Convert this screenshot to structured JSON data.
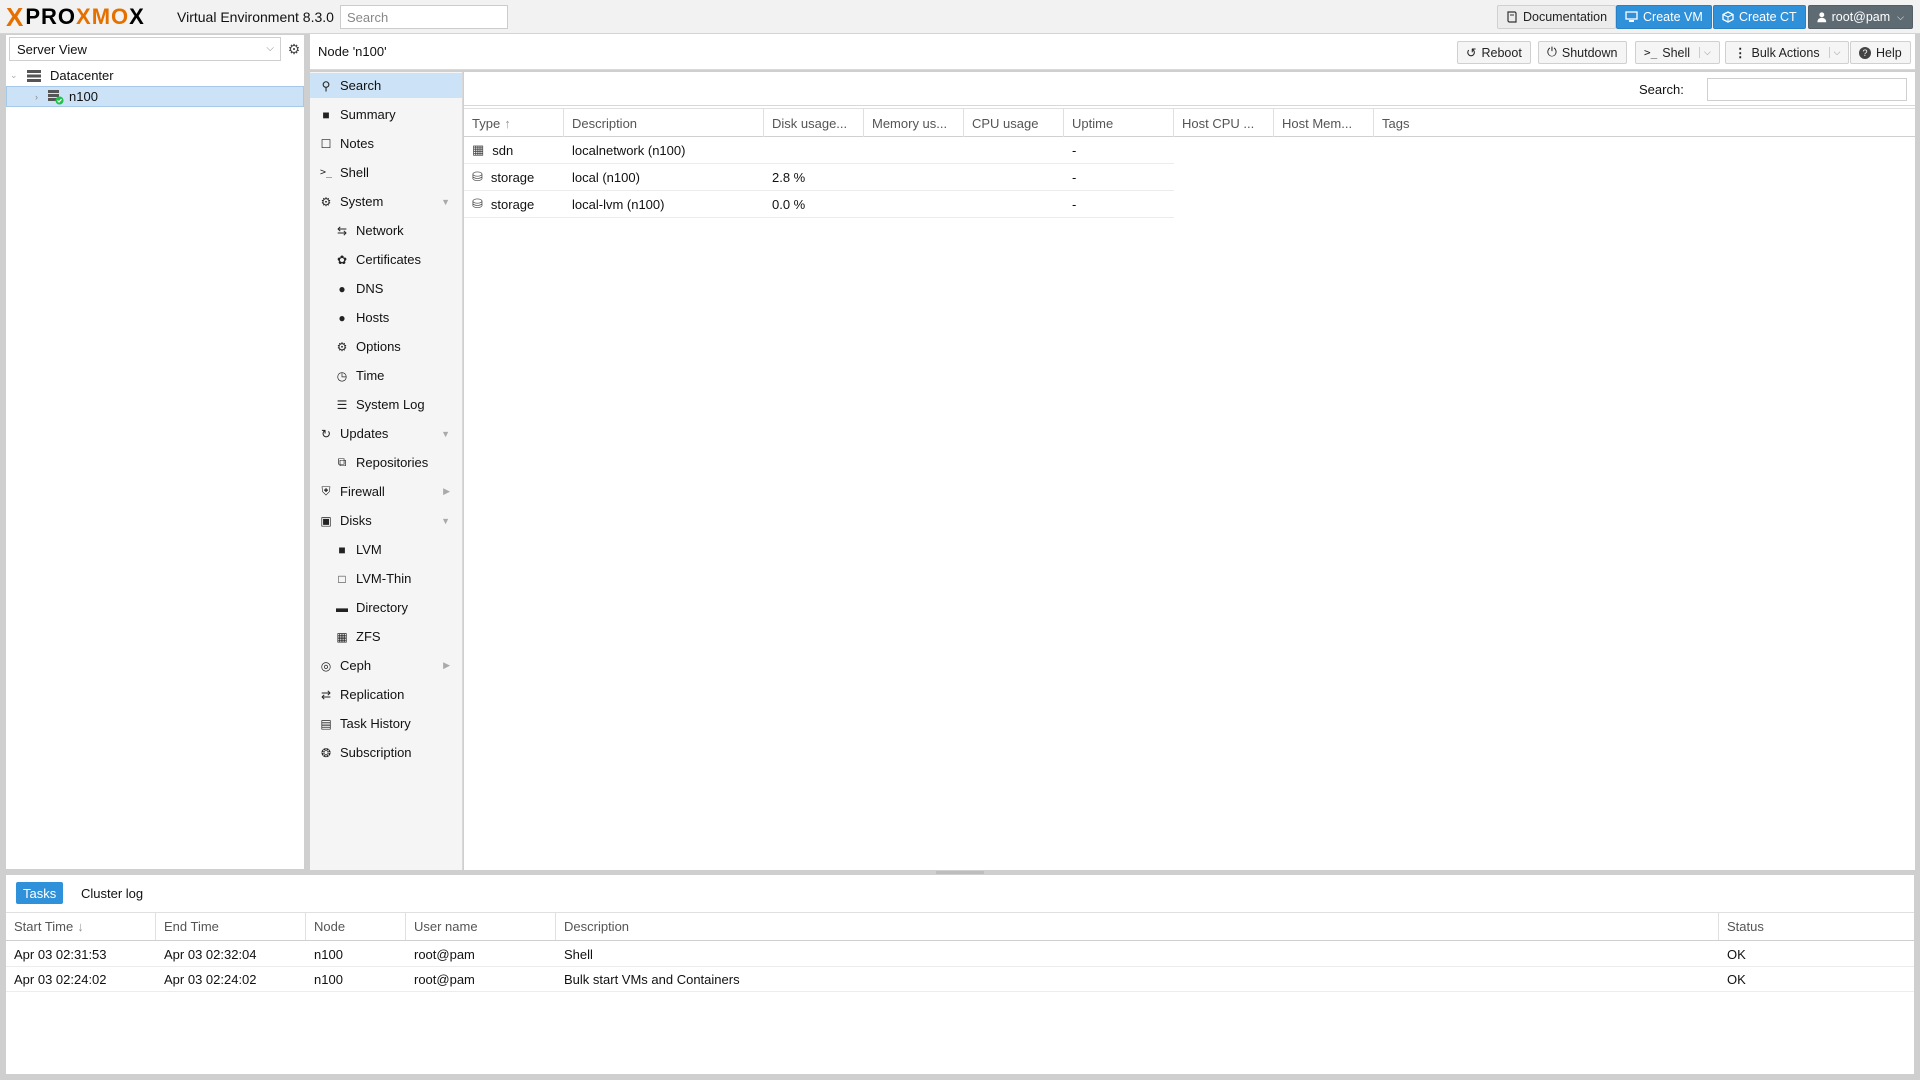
{
  "app": {
    "logo_x": "X",
    "logo_word_a": "PRO",
    "logo_word_b": "XMO",
    "logo_word_c": "X",
    "version": "Virtual Environment 8.3.0",
    "search_placeholder": "Search"
  },
  "topbar": {
    "documentation": "Documentation",
    "create_vm": "Create VM",
    "create_ct": "Create CT",
    "user": "root@pam"
  },
  "tree": {
    "view": "Server View",
    "datacenter": "Datacenter",
    "node": "n100"
  },
  "node_header": {
    "title": "Node 'n100'",
    "reboot": "Reboot",
    "shutdown": "Shutdown",
    "shell": "Shell",
    "bulk_actions": "Bulk Actions",
    "help": "Help"
  },
  "nav": [
    {
      "label": "Search",
      "icon": "search-icon"
    },
    {
      "label": "Summary",
      "icon": "book-icon"
    },
    {
      "label": "Notes",
      "icon": "notes-icon"
    },
    {
      "label": "Shell",
      "icon": "terminal-icon"
    },
    {
      "label": "System",
      "icon": "gears-icon"
    },
    {
      "label": "Network",
      "icon": "exchange-icon"
    },
    {
      "label": "Certificates",
      "icon": "certificate-icon"
    },
    {
      "label": "DNS",
      "icon": "globe-icon"
    },
    {
      "label": "Hosts",
      "icon": "globe-icon"
    },
    {
      "label": "Options",
      "icon": "gear-icon"
    },
    {
      "label": "Time",
      "icon": "clock-icon"
    },
    {
      "label": "System Log",
      "icon": "list-icon"
    },
    {
      "label": "Updates",
      "icon": "refresh-icon"
    },
    {
      "label": "Repositories",
      "icon": "files-icon"
    },
    {
      "label": "Firewall",
      "icon": "shield-icon"
    },
    {
      "label": "Disks",
      "icon": "hdd-icon"
    },
    {
      "label": "LVM",
      "icon": "square-icon"
    },
    {
      "label": "LVM-Thin",
      "icon": "square-outline-icon"
    },
    {
      "label": "Directory",
      "icon": "folder-icon"
    },
    {
      "label": "ZFS",
      "icon": "grid-icon"
    },
    {
      "label": "Ceph",
      "icon": "ceph-icon"
    },
    {
      "label": "Replication",
      "icon": "retweet-icon"
    },
    {
      "label": "Task History",
      "icon": "list-alt-icon"
    },
    {
      "label": "Subscription",
      "icon": "support-icon"
    }
  ],
  "grid": {
    "search_label": "Search:",
    "columns": [
      "Type",
      "Description",
      "Disk usage...",
      "Memory us...",
      "CPU usage",
      "Uptime",
      "Host CPU ...",
      "Host Mem...",
      "Tags"
    ],
    "rows": [
      {
        "type": "sdn",
        "description": "localnetwork (n100)",
        "disk": "",
        "uptime": "-"
      },
      {
        "type": "storage",
        "description": "local (n100)",
        "disk": "2.8 %",
        "uptime": "-"
      },
      {
        "type": "storage",
        "description": "local-lvm (n100)",
        "disk": "0.0 %",
        "uptime": "-"
      }
    ]
  },
  "log": {
    "tabs": [
      "Tasks",
      "Cluster log"
    ],
    "columns": [
      "Start Time",
      "End Time",
      "Node",
      "User name",
      "Description",
      "Status"
    ],
    "rows": [
      {
        "start": "Apr 03 02:31:53",
        "end": "Apr 03 02:32:04",
        "node": "n100",
        "user": "root@pam",
        "description": "Shell",
        "status": "OK"
      },
      {
        "start": "Apr 03 02:24:02",
        "end": "Apr 03 02:24:02",
        "node": "n100",
        "user": "root@pam",
        "description": "Bulk start VMs and Containers",
        "status": "OK"
      }
    ]
  },
  "colors": {
    "accent": "#e57000",
    "primary_button": "#2f91d9",
    "selection": "#cce3f7",
    "user_button": "#5f6b73"
  }
}
